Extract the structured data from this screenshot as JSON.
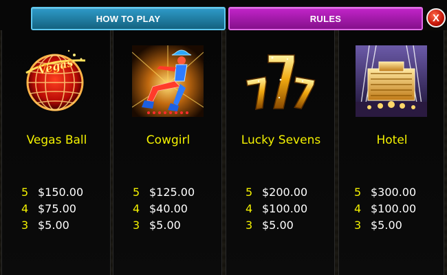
{
  "tabs": [
    {
      "label": "HOW TO PLAY",
      "color": "#1e7fa8"
    },
    {
      "label": "RULES",
      "color": "#a71aad"
    }
  ],
  "close_label": "X",
  "colors": {
    "symbol_name": "#f4f200",
    "pay_count": "#f4f200",
    "pay_value": "#ffffff"
  },
  "symbols": [
    {
      "name": "Vegas Ball",
      "icon": "vegas-ball-icon",
      "logo_text": "Vegas",
      "payouts": [
        {
          "count": "5",
          "value": "$150.00"
        },
        {
          "count": "4",
          "value": "$75.00"
        },
        {
          "count": "3",
          "value": "$5.00"
        }
      ]
    },
    {
      "name": "Cowgirl",
      "icon": "cowgirl-icon",
      "payouts": [
        {
          "count": "5",
          "value": "$125.00"
        },
        {
          "count": "4",
          "value": "$40.00"
        },
        {
          "count": "3",
          "value": "$5.00"
        }
      ]
    },
    {
      "name": "Lucky Sevens",
      "icon": "lucky-sevens-icon",
      "payouts": [
        {
          "count": "5",
          "value": "$200.00"
        },
        {
          "count": "4",
          "value": "$100.00"
        },
        {
          "count": "3",
          "value": "$5.00"
        }
      ]
    },
    {
      "name": "Hotel",
      "icon": "hotel-icon",
      "payouts": [
        {
          "count": "5",
          "value": "$300.00"
        },
        {
          "count": "4",
          "value": "$100.00"
        },
        {
          "count": "3",
          "value": "$5.00"
        }
      ]
    }
  ]
}
